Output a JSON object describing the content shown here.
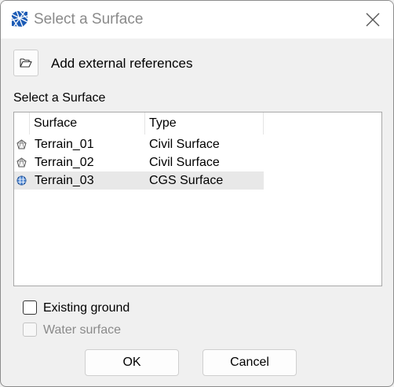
{
  "window": {
    "title": "Select a Surface",
    "icon": "surface-app-icon"
  },
  "toolbar": {
    "xref_icon": "open-folder-icon",
    "xref_label": "Add external references"
  },
  "surface_list": {
    "label": "Select a Surface",
    "columns": [
      "Surface",
      "Type"
    ],
    "rows": [
      {
        "surface": "Terrain_01",
        "type": "Civil Surface",
        "icon": "civil-surface-icon",
        "selected": false
      },
      {
        "surface": "Terrain_02",
        "type": "Civil Surface",
        "icon": "civil-surface-icon",
        "selected": false
      },
      {
        "surface": "Terrain_03",
        "type": "CGS Surface",
        "icon": "cgs-surface-icon",
        "selected": true
      }
    ]
  },
  "options": {
    "existing_ground": {
      "label": "Existing ground",
      "checked": false,
      "enabled": true
    },
    "water_surface": {
      "label": "Water surface",
      "checked": false,
      "enabled": false
    }
  },
  "buttons": {
    "ok": "OK",
    "cancel": "Cancel"
  },
  "colors": {
    "selection": "#e8e8e8",
    "disabled_text": "#8a8a8a",
    "app_icon_blue": "#1c5bb5"
  }
}
